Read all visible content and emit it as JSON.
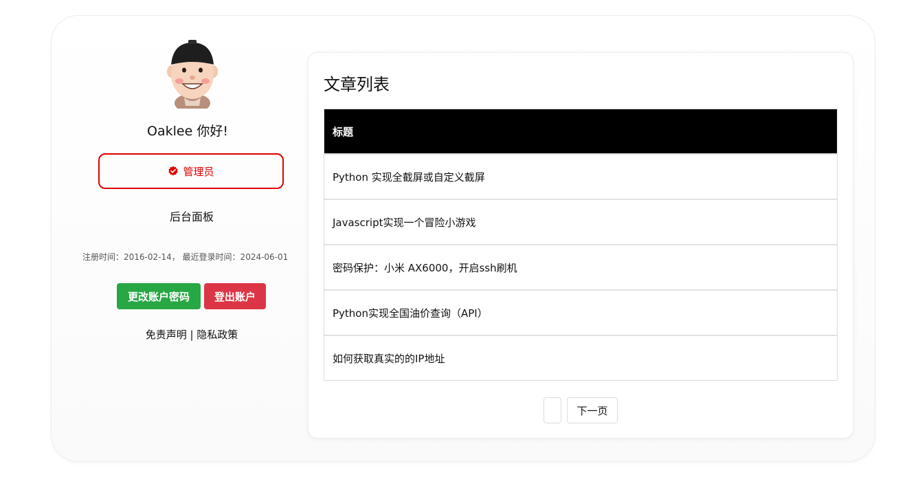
{
  "profile": {
    "greeting": "Oaklee 你好!",
    "role": "管理员",
    "admin_panel": "后台面板",
    "registration_info": "注册时间：2016-02-14， 最近登录时间：2024-06-01",
    "change_password_button": "更改账户密码",
    "logout_button": "登出账户",
    "disclaimer_link": "免责声明",
    "separator": " | ",
    "privacy_link": "隐私政策",
    "role_color": "#e00000",
    "green": "#28a745",
    "red": "#dc3545"
  },
  "articles": {
    "title": "文章列表",
    "column_header": "标题",
    "rows": [
      "Python 实现全截屏或自定义截屏",
      "Javascript实现一个冒险小游戏",
      "密码保护：小米 AX6000，开启ssh刷机",
      "Python实现全国油价查询（API）",
      "如何获取真实的的IP地址"
    ],
    "pager": {
      "prev_label": "",
      "next_label": "下一页"
    }
  }
}
